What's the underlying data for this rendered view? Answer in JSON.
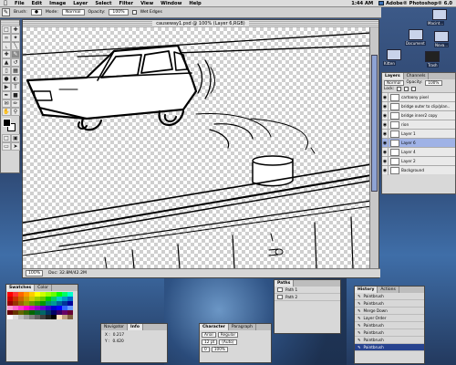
{
  "menubar": {
    "items": [
      "File",
      "Edit",
      "Image",
      "Layer",
      "Select",
      "Filter",
      "View",
      "Window",
      "Help"
    ],
    "time": "1:44 AM",
    "app_name": "Adobe® Photoshop® 6.0"
  },
  "options_bar": {
    "brush_label": "Brush:",
    "mode_label": "Mode:",
    "mode_value": "Normal",
    "opacity_label": "Opacity:",
    "opacity_value": "100%",
    "wet_edges_label": "Wet Edges"
  },
  "document": {
    "title": "causeway1.psd @ 100% (Layer 6,RGB)",
    "zoom": "100%",
    "doc_size": "Doc: 32.8M/42.2M"
  },
  "desktop_icons": [
    {
      "label": "Macint..."
    },
    {
      "label": "Document"
    },
    {
      "label": "Nova..."
    },
    {
      "label": "Kitten"
    },
    {
      "label": "Trash"
    }
  ],
  "layers_panel": {
    "tabs": [
      "Layers",
      "Channels"
    ],
    "blend_mode": "Normal",
    "opacity_label": "Opacity:",
    "opacity_value": "100%",
    "lock_label": "Lock:",
    "layers": [
      {
        "name": "cartoony pixel",
        "selected": false
      },
      {
        "name": "bridge outer to clip/plan..",
        "selected": false
      },
      {
        "name": "bridge inner2 copy",
        "selected": false
      },
      {
        "name": "rion",
        "selected": false
      },
      {
        "name": "Layer 1",
        "selected": false
      },
      {
        "name": "Layer 6",
        "selected": true
      },
      {
        "name": "Layer 4",
        "selected": false
      },
      {
        "name": "Layer 2",
        "selected": false
      },
      {
        "name": "Background",
        "selected": false
      }
    ]
  },
  "swatches_panel": {
    "tabs": [
      "Swatches",
      "Color"
    ],
    "colors": [
      "#ff0000",
      "#ff3333",
      "#ff6600",
      "#ff9900",
      "#ffcc00",
      "#ffff00",
      "#ccff00",
      "#99ff00",
      "#66ff00",
      "#00ff00",
      "#00ff66",
      "#00ffcc",
      "#cc0000",
      "#cc3300",
      "#cc6600",
      "#cc9900",
      "#cccc00",
      "#99cc00",
      "#66cc00",
      "#00cc00",
      "#00cc66",
      "#00cccc",
      "#0099cc",
      "#0066cc",
      "#990000",
      "#993300",
      "#996600",
      "#999900",
      "#669900",
      "#339900",
      "#009900",
      "#009966",
      "#009999",
      "#006699",
      "#003399",
      "#000099",
      "#ff99cc",
      "#ff66cc",
      "#ff33cc",
      "#ff00cc",
      "#cc00cc",
      "#9900cc",
      "#6600cc",
      "#3300cc",
      "#0000cc",
      "#0000ff",
      "#3366ff",
      "#6699ff",
      "#660000",
      "#663300",
      "#666600",
      "#336600",
      "#006600",
      "#006633",
      "#006666",
      "#003366",
      "#000066",
      "#330066",
      "#660066",
      "#660033",
      "#ffffff",
      "#e0e0e0",
      "#c0c0c0",
      "#a0a0a0",
      "#808080",
      "#606060",
      "#404040",
      "#202020",
      "#000000",
      "#ffe0c0",
      "#c0a080",
      "#806040"
    ]
  },
  "navigator_panel": {
    "tabs": [
      "Navigator",
      "Info"
    ],
    "x_label": "X :",
    "x_value": "0.217",
    "y_label": "Y :",
    "y_value": "0.420"
  },
  "character_panel": {
    "tabs": [
      "Character",
      "Paragraph"
    ],
    "font": "Arial",
    "style": "Regular",
    "size": "12 pt",
    "leading": "(Auto)",
    "tracking": "0",
    "scale": "100%"
  },
  "paths_panel": {
    "tab": "Paths",
    "items": [
      "Path 1",
      "Path 2"
    ]
  },
  "history_panel": {
    "tabs": [
      "History",
      "Actions"
    ],
    "items": [
      "Paintbrush",
      "Paintbrush",
      "Merge Down",
      "Layer Order",
      "Paintbrush",
      "Paintbrush",
      "Paintbrush",
      "Paintbrush"
    ]
  },
  "colors": {
    "selection_blue": "#9fb2e6",
    "history_current": "#27438f",
    "menubar_gray": "#dcdcdc"
  }
}
